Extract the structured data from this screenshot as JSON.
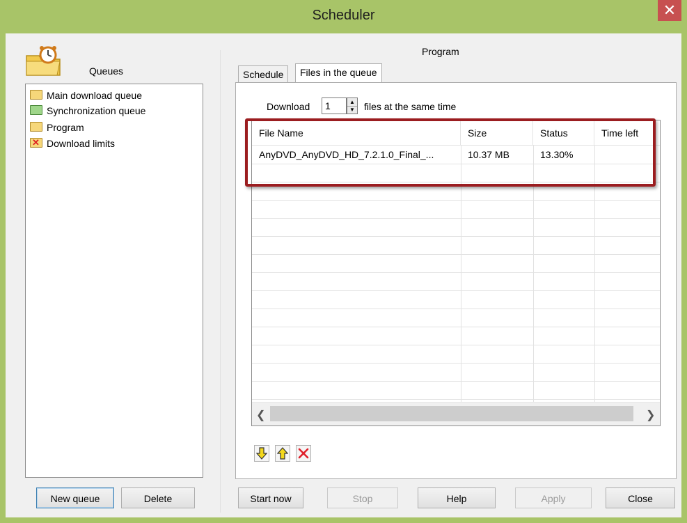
{
  "window": {
    "title": "Scheduler",
    "close_glyph": "✕"
  },
  "left_panel": {
    "label": "Queues",
    "icon": "alarm-clock-folder-icon",
    "queues": [
      {
        "label": "Main download queue",
        "icon": "folder-icon"
      },
      {
        "label": "Synchronization queue",
        "icon": "green-folder-icon"
      },
      {
        "label": "Program",
        "icon": "folder-icon"
      },
      {
        "label": "Download limits",
        "icon": "folder-blocked-icon"
      }
    ],
    "new_queue_label": "New queue",
    "delete_label": "Delete"
  },
  "right_panel": {
    "title": "Program",
    "tabs": [
      {
        "label": "Schedule",
        "active": false
      },
      {
        "label": "Files in the queue",
        "active": true
      }
    ],
    "download_label": "Download",
    "download_count": "1",
    "download_suffix": "files at the same time",
    "columns": [
      "File Name",
      "Size",
      "Status",
      "Time left"
    ],
    "rows": [
      {
        "file_name": "AnyDVD_AnyDVD_HD_7.2.1.0_Final_...",
        "size": "10.37  MB",
        "status": "13.30%",
        "time_left": ""
      }
    ],
    "toolbar_icons": [
      "move-down-icon",
      "move-up-icon",
      "delete-icon"
    ]
  },
  "buttons": {
    "start_now": "Start now",
    "stop": "Stop",
    "help": "Help",
    "apply": "Apply",
    "close": "Close"
  },
  "colors": {
    "frame": "#a8c468",
    "close_button": "#c75050",
    "highlight_border": "#9b1d20"
  }
}
